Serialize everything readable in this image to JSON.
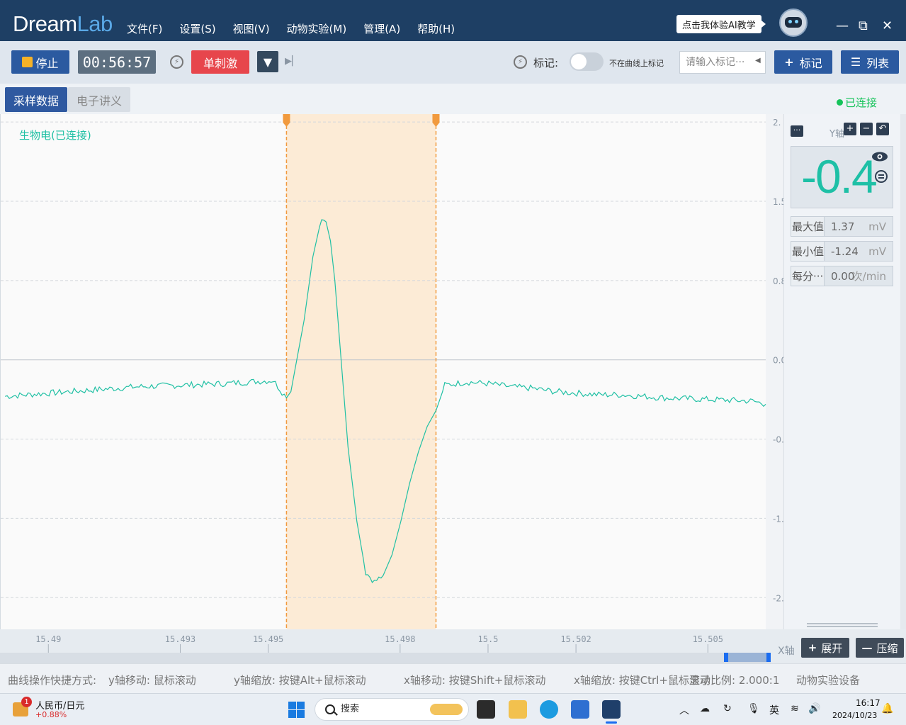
{
  "app": {
    "logo_main": "Dream",
    "logo_accent": "Lab",
    "menu": [
      "文件(F)",
      "设置(S)",
      "视图(V)",
      "动物实验(M)",
      "管理(A)",
      "帮助(H)"
    ],
    "ai_tip": "点击我体验AI教学",
    "window_controls": {
      "minimize": "—",
      "restore": "⧉",
      "close": "✕"
    }
  },
  "toolbar": {
    "stop_label": "停止",
    "timer": "00:56:57",
    "stim_label": "单刺激",
    "mark_label": "标记:",
    "toggle_label": "不在曲线上标记",
    "mark_input_placeholder": "请输入标记···",
    "add_mark_label": "标记",
    "list_label": "列表"
  },
  "tabs": {
    "active": "采样数据",
    "inactive": "电子讲义"
  },
  "status": {
    "connected": "已连接"
  },
  "chart": {
    "channel_label": "生物电(已连接)"
  },
  "panel": {
    "y_axis_label": "Y轴",
    "current_value": "-0.4",
    "stats": [
      {
        "key": "最大值",
        "value": "1.37",
        "unit": "mV"
      },
      {
        "key": "最小值",
        "value": "-1.24",
        "unit": "mV"
      },
      {
        "key": "每分···",
        "value": "0.00",
        "unit": "次/min"
      }
    ]
  },
  "xaxis": {
    "label": "X轴",
    "expand_label": "展开",
    "compress_label": "压缩"
  },
  "statusbar": {
    "hint1": "曲线操作快捷方式:",
    "hint2": "y轴移动: 鼠标滚动",
    "hint3": "y轴缩放: 按键Alt+鼠标滚动",
    "hint4": "x轴移动: 按键Shift+鼠标滚动",
    "hint5": "x轴缩放: 按键Ctrl+鼠标滚动",
    "scale": "显示比例: 2.000:1",
    "device": "动物实验设备"
  },
  "taskbar": {
    "rate_label": "人民币/日元",
    "rate_change": "+0.88%",
    "badge": "1",
    "search_placeholder": "搜索",
    "ime": "英",
    "time": "16:17",
    "date": "2024/10/23"
  },
  "chart_data": {
    "type": "line",
    "x_ticks": [
      "15.49",
      "15.493",
      "15.495",
      "15.498",
      "15.5",
      "15.502",
      "15.505"
    ],
    "x_tick_values": [
      15.49,
      15.493,
      15.495,
      15.498,
      15.5,
      15.502,
      15.505
    ],
    "y_ticks": [
      "2.",
      "1.5",
      "0.8",
      "0.0",
      "-0.",
      "-1.",
      "-2."
    ],
    "y_tick_values": [
      2.0,
      1.5,
      1.0,
      0.5,
      0.0,
      -0.5,
      -1.0
    ],
    "xlim": [
      15.4889,
      15.5063
    ],
    "ylim": [
      -1.2,
      2.05
    ],
    "grid": true,
    "selection": {
      "start": 15.4954,
      "end": 15.4988
    },
    "series": [
      {
        "x": [
          15.489,
          15.49,
          15.491,
          15.492,
          15.493,
          15.494,
          15.4945,
          15.4951,
          15.4954,
          15.4955,
          15.4956,
          15.4958,
          15.496,
          15.4962,
          15.4963,
          15.4964,
          15.4965,
          15.4966,
          15.4967,
          15.4968,
          15.497,
          15.4972,
          15.4974,
          15.4976,
          15.4978,
          15.498,
          15.4982,
          15.4984,
          15.4986,
          15.4988,
          15.499,
          15.4995,
          15.5,
          15.5005,
          15.501,
          15.5015,
          15.502,
          15.5025,
          15.503,
          15.5035,
          15.504,
          15.505,
          15.506,
          15.5063
        ],
        "y": [
          0.27,
          0.29,
          0.31,
          0.33,
          0.34,
          0.35,
          0.36,
          0.37,
          0.26,
          0.3,
          0.45,
          0.75,
          1.15,
          1.4,
          1.37,
          1.25,
          1.0,
          0.65,
          0.3,
          -0.05,
          -0.52,
          -0.84,
          -0.9,
          -0.86,
          -0.73,
          -0.52,
          -0.28,
          -0.08,
          0.08,
          0.18,
          0.34,
          0.36,
          0.35,
          0.33,
          0.32,
          0.3,
          0.29,
          0.28,
          0.28,
          0.27,
          0.26,
          0.25,
          0.24,
          0.22
        ]
      }
    ]
  }
}
